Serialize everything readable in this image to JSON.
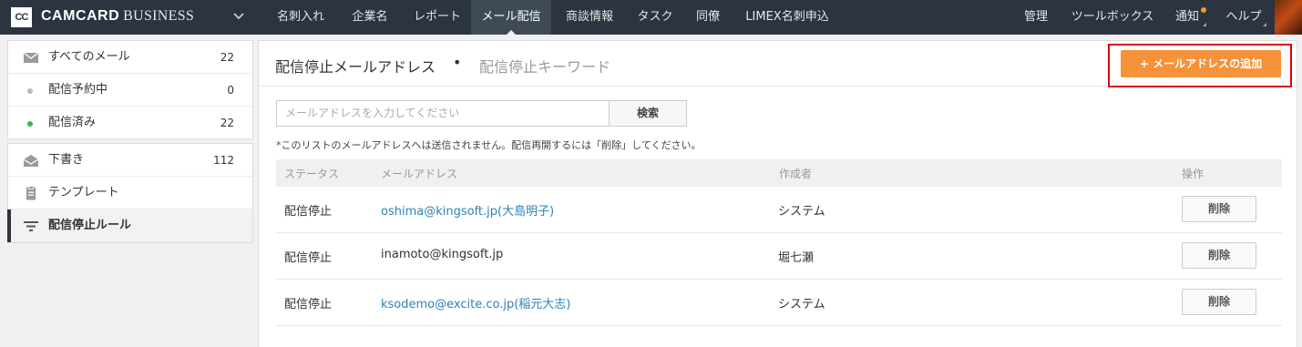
{
  "brand": {
    "logo_mark": "CC",
    "name": "CAMCARD",
    "suffix": "BUSINESS"
  },
  "nav": {
    "items": [
      {
        "label": "名刺入れ"
      },
      {
        "label": "企業名"
      },
      {
        "label": "レポート"
      },
      {
        "label": "メール配信",
        "active": true
      },
      {
        "label": "商談情報"
      },
      {
        "label": "タスク"
      },
      {
        "label": "同僚"
      },
      {
        "label": "LIMEX名刺申込"
      }
    ],
    "right": [
      {
        "label": "管理"
      },
      {
        "label": "ツールボックス"
      },
      {
        "label": "通知"
      },
      {
        "label": "ヘルプ"
      }
    ]
  },
  "sidebar": {
    "group1": [
      {
        "label": "すべてのメール",
        "count": "22",
        "icon": "envelope-icon"
      },
      {
        "label": "配信予約中",
        "count": "0",
        "dot_color": "#bbbbbb"
      },
      {
        "label": "配信済み",
        "count": "22",
        "dot_color": "#3cb54a"
      }
    ],
    "group2": [
      {
        "label": "下書き",
        "count": "112",
        "icon": "open-envelope-icon"
      },
      {
        "label": "テンプレート",
        "icon": "clipboard-icon"
      },
      {
        "label": "配信停止ルール",
        "icon": "filter-icon",
        "active": true
      }
    ]
  },
  "main": {
    "tab_active": "配信停止メールアドレス",
    "bullet": "•",
    "tab_inactive": "配信停止キーワード",
    "add_button": "+ メールアドレスの追加",
    "search": {
      "placeholder": "メールアドレスを入力してください",
      "button": "検索"
    },
    "note": "*このリストのメールアドレスへは送信されません。配信再開するには「削除」してください。",
    "columns": [
      "ステータス",
      "メールアドレス",
      "作成者",
      "操作"
    ],
    "rows": [
      {
        "status": "配信停止",
        "email": "oshima@kingsoft.jp(大島明子)",
        "creator": "システム",
        "action": "削除",
        "email_is_link": true
      },
      {
        "status": "配信停止",
        "email": "inamoto@kingsoft.jp",
        "creator": "堀七瀬",
        "action": "削除",
        "email_is_link": false
      },
      {
        "status": "配信停止",
        "email": "ksodemo@excite.co.jp(稲元大志)",
        "creator": "システム",
        "action": "削除",
        "email_is_link": true
      }
    ]
  },
  "colors": {
    "topbar": "#2c3440",
    "accent": "#f6923a",
    "link": "#2d83b4",
    "highlight": "#e20000"
  }
}
